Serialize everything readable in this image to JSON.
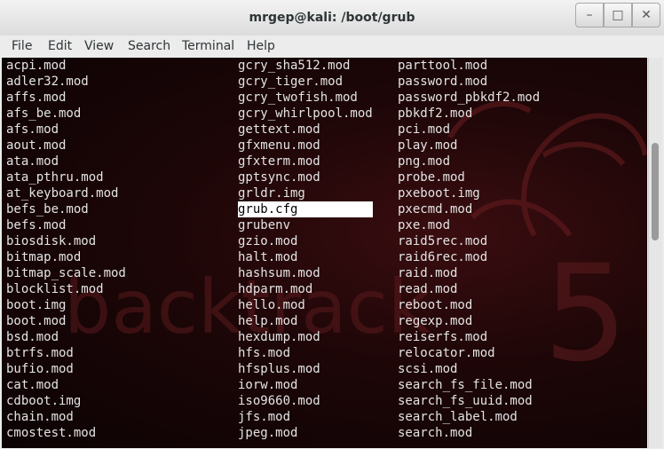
{
  "window": {
    "title": "mrgep@kali: /boot/grub",
    "controls": [
      "minimize-icon",
      "maximize-icon",
      "close-icon"
    ]
  },
  "menu": [
    "File",
    "Edit",
    "View",
    "Search",
    "Terminal",
    "Help"
  ],
  "wallpaper_text": {
    "brand": "backtrack",
    "version": "5"
  },
  "terminal": {
    "columns": [
      [
        "acpi.mod",
        "adler32.mod",
        "affs.mod",
        "afs_be.mod",
        "afs.mod",
        "aout.mod",
        "ata.mod",
        "ata_pthru.mod",
        "at_keyboard.mod",
        "befs_be.mod",
        "befs.mod",
        "biosdisk.mod",
        "bitmap.mod",
        "bitmap_scale.mod",
        "blocklist.mod",
        "boot.img",
        "boot.mod",
        "bsd.mod",
        "btrfs.mod",
        "bufio.mod",
        "cat.mod",
        "cdboot.img",
        "chain.mod",
        "cmostest.mod"
      ],
      [
        "gcry_sha512.mod",
        "gcry_tiger.mod",
        "gcry_twofish.mod",
        "gcry_whirlpool.mod",
        "gettext.mod",
        "gfxmenu.mod",
        "gfxterm.mod",
        "gptsync.mod",
        "grldr.img",
        "grub.cfg",
        "grubenv",
        "gzio.mod",
        "halt.mod",
        "hashsum.mod",
        "hdparm.mod",
        "hello.mod",
        "help.mod",
        "hexdump.mod",
        "hfs.mod",
        "hfsplus.mod",
        "iorw.mod",
        "iso9660.mod",
        "jfs.mod",
        "jpeg.mod"
      ],
      [
        "parttool.mod",
        "password.mod",
        "password_pbkdf2.mod",
        "pbkdf2.mod",
        "pci.mod",
        "play.mod",
        "png.mod",
        "probe.mod",
        "pxeboot.img",
        "pxecmd.mod",
        "pxe.mod",
        "raid5rec.mod",
        "raid6rec.mod",
        "raid.mod",
        "read.mod",
        "reboot.mod",
        "regexp.mod",
        "reiserfs.mod",
        "relocator.mod",
        "scsi.mod",
        "search_fs_file.mod",
        "search_fs_uuid.mod",
        "search_label.mod",
        "search.mod"
      ]
    ],
    "selected": "grub.cfg",
    "colors": {
      "text": "#e4e4e4",
      "background": "#1d0607",
      "highlight_bg": "#ffffff",
      "highlight_fg": "#000000"
    }
  }
}
